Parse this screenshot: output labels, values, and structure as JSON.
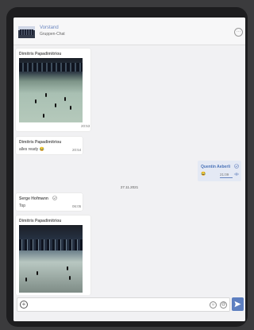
{
  "header": {
    "group_name": "Vorstand",
    "group_subtitle": "Gruppen-Chat",
    "more_glyph": "···"
  },
  "messages": [
    {
      "sender": "Dimitris Papadimitriou",
      "type": "image",
      "time": "20:53"
    },
    {
      "sender": "Dimitris Papadimitriou",
      "type": "text",
      "text": "alles ready 😂",
      "time": "20:54"
    },
    {
      "sender": "Quentin Aeberli",
      "type": "text",
      "text": "😂",
      "time": "21:09",
      "own": true
    },
    {
      "sender": "Serge Hofmann",
      "type": "text",
      "text": "Top",
      "time": "06:05"
    },
    {
      "sender": "Dimitris Papadimitriou",
      "type": "image",
      "time": ""
    }
  ],
  "date_separator": "27.11.2021",
  "footer": {
    "input_placeholder": "",
    "add_glyph": "+",
    "emoji_glyph": "☺",
    "mention_glyph": "@"
  },
  "colors": {
    "accent": "#5d7fc0",
    "own_bubble": "#e4e9f4"
  },
  "icons": [
    "group-avatar",
    "more-icon",
    "verified-icon",
    "read-receipt-icon",
    "add-icon",
    "emoji-icon",
    "mention-icon",
    "send-icon"
  ]
}
